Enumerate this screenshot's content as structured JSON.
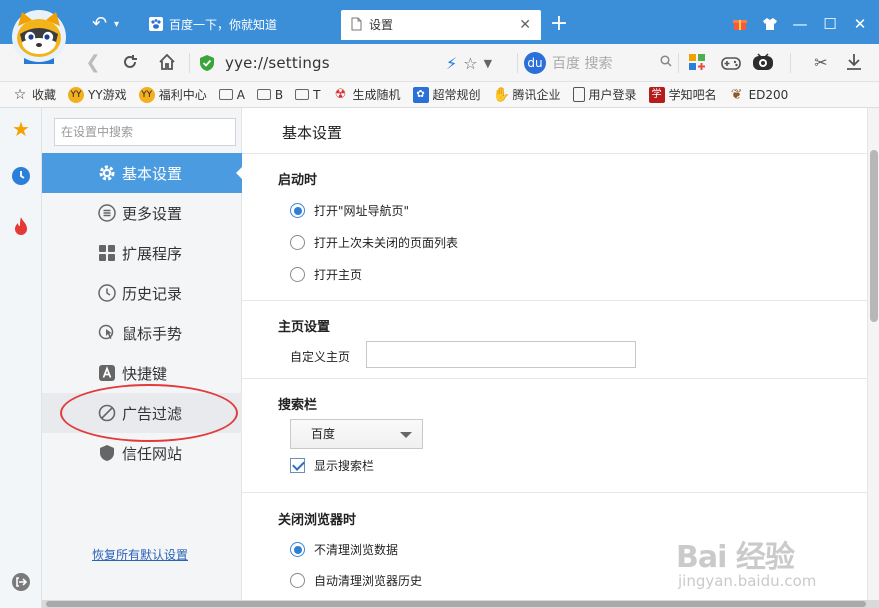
{
  "browser": {
    "tabs": [
      {
        "label": "百度一下，你就知道",
        "active": false
      },
      {
        "label": "设置",
        "active": true
      }
    ],
    "address": {
      "url": "yye://settings"
    },
    "search": {
      "placeholder": "百度 搜索",
      "engine_logo": "du"
    },
    "colors": {
      "titlebar": "#3b8fd9",
      "accent": "#4a9be0"
    }
  },
  "bookmarks": [
    {
      "label": "收藏",
      "icon": "star-outline-icon"
    },
    {
      "label": "YY游戏",
      "icon": "yy-icon"
    },
    {
      "label": "福利中心",
      "icon": "yy-icon"
    },
    {
      "label": "A",
      "icon": "folder-icon"
    },
    {
      "label": "B",
      "icon": "folder-icon"
    },
    {
      "label": "T",
      "icon": "folder-icon"
    },
    {
      "label": "生成随机",
      "icon": "bot-icon"
    },
    {
      "label": "超常规创",
      "icon": "paw-icon"
    },
    {
      "label": "腾讯企业",
      "icon": "hand-icon"
    },
    {
      "label": "用户登录",
      "icon": "page-icon"
    },
    {
      "label": "学知吧名",
      "icon": "xue-icon"
    },
    {
      "label": "ED200",
      "icon": "ed-icon"
    }
  ],
  "sidebar_nav": {
    "search_placeholder": "在设置中搜索",
    "items": [
      {
        "label": "基本设置",
        "icon": "gear-icon",
        "active": true
      },
      {
        "label": "更多设置",
        "icon": "list-icon",
        "active": false
      },
      {
        "label": "扩展程序",
        "icon": "grid-icon",
        "active": false
      },
      {
        "label": "历史记录",
        "icon": "clock-icon",
        "active": false
      },
      {
        "label": "鼠标手势",
        "icon": "gesture-icon",
        "active": false
      },
      {
        "label": "快捷键",
        "icon": "keyboard-a-icon",
        "active": false
      },
      {
        "label": "广告过滤",
        "icon": "block-icon",
        "active": false
      },
      {
        "label": "信任网站",
        "icon": "shield-icon",
        "active": false
      }
    ],
    "restore_link": "恢复所有默认设置"
  },
  "main": {
    "title": "基本设置",
    "startup": {
      "title": "启动时",
      "options": [
        {
          "label": "打开\"网址导航页\"",
          "checked": true
        },
        {
          "label": "打开上次未关闭的页面列表",
          "checked": false
        },
        {
          "label": "打开主页",
          "checked": false
        }
      ]
    },
    "homepage": {
      "title": "主页设置",
      "field_label": "自定义主页",
      "value": ""
    },
    "searchbar": {
      "title": "搜索栏",
      "selected_engine": "百度",
      "show_label": "显示搜索栏",
      "show_checked": true
    },
    "on_close": {
      "title": "关闭浏览器时",
      "options": [
        {
          "label": "不清理浏览数据",
          "checked": true
        },
        {
          "label": "自动清理浏览器历史",
          "checked": false
        }
      ]
    }
  },
  "watermark": {
    "big": "Bai 经验",
    "small": "jingyan.baidu.com"
  }
}
